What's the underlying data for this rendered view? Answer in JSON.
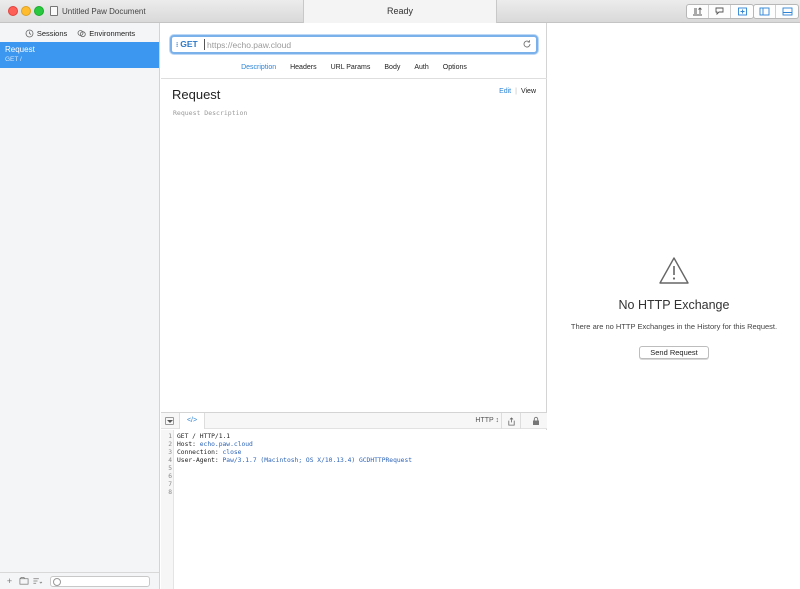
{
  "window": {
    "document_title": "Untitled Paw Document",
    "status": "Ready"
  },
  "sidebar": {
    "tabs": [
      {
        "label": "Sessions",
        "icon": "history-icon"
      },
      {
        "label": "Environments",
        "icon": "environments-icon"
      }
    ],
    "requests": [
      {
        "name": "Request",
        "subtitle": "GET /"
      }
    ]
  },
  "request": {
    "method": "GET",
    "url_placeholder": "https://echo.paw.cloud",
    "url_value": "",
    "tabs": [
      "Description",
      "Headers",
      "URL Params",
      "Body",
      "Auth",
      "Options"
    ],
    "active_tab": "Description",
    "title": "Request",
    "edit_label": "Edit",
    "view_label": "View",
    "description_placeholder": "Request Description"
  },
  "code_panel": {
    "format": "HTTP ↕",
    "code_button": "</>",
    "lines": [
      {
        "n": "1",
        "text": "GET / HTTP/1.1",
        "value": ""
      },
      {
        "n": "2",
        "text": "Host: ",
        "value": "echo.paw.cloud"
      },
      {
        "n": "3",
        "text": "Connection: ",
        "value": "close"
      },
      {
        "n": "4",
        "text": "User-Agent: ",
        "value": "Paw/3.1.7 (Macintosh; OS X/10.13.4) GCDHTTPRequest"
      },
      {
        "n": "5",
        "text": "",
        "value": ""
      },
      {
        "n": "6",
        "text": "",
        "value": ""
      },
      {
        "n": "7",
        "text": "",
        "value": ""
      },
      {
        "n": "8",
        "text": "",
        "value": ""
      }
    ]
  },
  "response": {
    "title": "No HTTP Exchange",
    "description": "There are no HTTP Exchanges in the History for this Request.",
    "send_label": "Send Request"
  },
  "colors": {
    "accent": "#3c97f0",
    "link": "#2c84d6"
  }
}
